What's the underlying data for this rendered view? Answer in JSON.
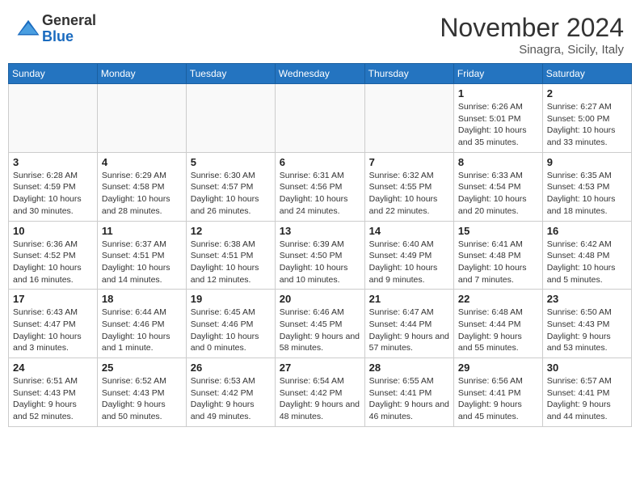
{
  "header": {
    "logo_general": "General",
    "logo_blue": "Blue",
    "month_title": "November 2024",
    "subtitle": "Sinagra, Sicily, Italy"
  },
  "weekdays": [
    "Sunday",
    "Monday",
    "Tuesday",
    "Wednesday",
    "Thursday",
    "Friday",
    "Saturday"
  ],
  "weeks": [
    [
      {
        "day": "",
        "info": ""
      },
      {
        "day": "",
        "info": ""
      },
      {
        "day": "",
        "info": ""
      },
      {
        "day": "",
        "info": ""
      },
      {
        "day": "",
        "info": ""
      },
      {
        "day": "1",
        "info": "Sunrise: 6:26 AM\nSunset: 5:01 PM\nDaylight: 10 hours and 35 minutes."
      },
      {
        "day": "2",
        "info": "Sunrise: 6:27 AM\nSunset: 5:00 PM\nDaylight: 10 hours and 33 minutes."
      }
    ],
    [
      {
        "day": "3",
        "info": "Sunrise: 6:28 AM\nSunset: 4:59 PM\nDaylight: 10 hours and 30 minutes."
      },
      {
        "day": "4",
        "info": "Sunrise: 6:29 AM\nSunset: 4:58 PM\nDaylight: 10 hours and 28 minutes."
      },
      {
        "day": "5",
        "info": "Sunrise: 6:30 AM\nSunset: 4:57 PM\nDaylight: 10 hours and 26 minutes."
      },
      {
        "day": "6",
        "info": "Sunrise: 6:31 AM\nSunset: 4:56 PM\nDaylight: 10 hours and 24 minutes."
      },
      {
        "day": "7",
        "info": "Sunrise: 6:32 AM\nSunset: 4:55 PM\nDaylight: 10 hours and 22 minutes."
      },
      {
        "day": "8",
        "info": "Sunrise: 6:33 AM\nSunset: 4:54 PM\nDaylight: 10 hours and 20 minutes."
      },
      {
        "day": "9",
        "info": "Sunrise: 6:35 AM\nSunset: 4:53 PM\nDaylight: 10 hours and 18 minutes."
      }
    ],
    [
      {
        "day": "10",
        "info": "Sunrise: 6:36 AM\nSunset: 4:52 PM\nDaylight: 10 hours and 16 minutes."
      },
      {
        "day": "11",
        "info": "Sunrise: 6:37 AM\nSunset: 4:51 PM\nDaylight: 10 hours and 14 minutes."
      },
      {
        "day": "12",
        "info": "Sunrise: 6:38 AM\nSunset: 4:51 PM\nDaylight: 10 hours and 12 minutes."
      },
      {
        "day": "13",
        "info": "Sunrise: 6:39 AM\nSunset: 4:50 PM\nDaylight: 10 hours and 10 minutes."
      },
      {
        "day": "14",
        "info": "Sunrise: 6:40 AM\nSunset: 4:49 PM\nDaylight: 10 hours and 9 minutes."
      },
      {
        "day": "15",
        "info": "Sunrise: 6:41 AM\nSunset: 4:48 PM\nDaylight: 10 hours and 7 minutes."
      },
      {
        "day": "16",
        "info": "Sunrise: 6:42 AM\nSunset: 4:48 PM\nDaylight: 10 hours and 5 minutes."
      }
    ],
    [
      {
        "day": "17",
        "info": "Sunrise: 6:43 AM\nSunset: 4:47 PM\nDaylight: 10 hours and 3 minutes."
      },
      {
        "day": "18",
        "info": "Sunrise: 6:44 AM\nSunset: 4:46 PM\nDaylight: 10 hours and 1 minute."
      },
      {
        "day": "19",
        "info": "Sunrise: 6:45 AM\nSunset: 4:46 PM\nDaylight: 10 hours and 0 minutes."
      },
      {
        "day": "20",
        "info": "Sunrise: 6:46 AM\nSunset: 4:45 PM\nDaylight: 9 hours and 58 minutes."
      },
      {
        "day": "21",
        "info": "Sunrise: 6:47 AM\nSunset: 4:44 PM\nDaylight: 9 hours and 57 minutes."
      },
      {
        "day": "22",
        "info": "Sunrise: 6:48 AM\nSunset: 4:44 PM\nDaylight: 9 hours and 55 minutes."
      },
      {
        "day": "23",
        "info": "Sunrise: 6:50 AM\nSunset: 4:43 PM\nDaylight: 9 hours and 53 minutes."
      }
    ],
    [
      {
        "day": "24",
        "info": "Sunrise: 6:51 AM\nSunset: 4:43 PM\nDaylight: 9 hours and 52 minutes."
      },
      {
        "day": "25",
        "info": "Sunrise: 6:52 AM\nSunset: 4:43 PM\nDaylight: 9 hours and 50 minutes."
      },
      {
        "day": "26",
        "info": "Sunrise: 6:53 AM\nSunset: 4:42 PM\nDaylight: 9 hours and 49 minutes."
      },
      {
        "day": "27",
        "info": "Sunrise: 6:54 AM\nSunset: 4:42 PM\nDaylight: 9 hours and 48 minutes."
      },
      {
        "day": "28",
        "info": "Sunrise: 6:55 AM\nSunset: 4:41 PM\nDaylight: 9 hours and 46 minutes."
      },
      {
        "day": "29",
        "info": "Sunrise: 6:56 AM\nSunset: 4:41 PM\nDaylight: 9 hours and 45 minutes."
      },
      {
        "day": "30",
        "info": "Sunrise: 6:57 AM\nSunset: 4:41 PM\nDaylight: 9 hours and 44 minutes."
      }
    ]
  ]
}
